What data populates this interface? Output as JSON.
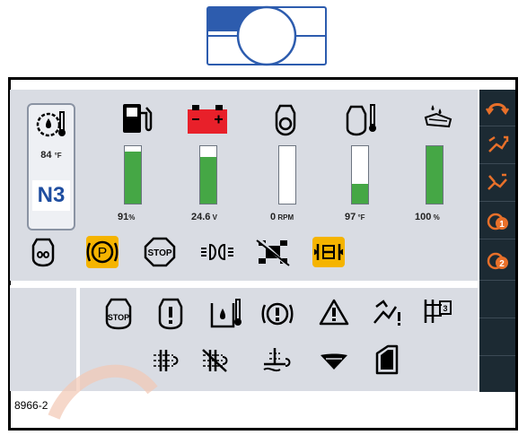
{
  "engine": {
    "temp_value": "84",
    "temp_unit": "°F",
    "gear": "N3"
  },
  "gauges": [
    {
      "name": "fuel",
      "value": "91",
      "unit": "%",
      "level": 0.91
    },
    {
      "name": "battery",
      "value": "24.6",
      "unit": "V",
      "level": 0.82
    },
    {
      "name": "engine-speed",
      "value": "0",
      "unit": "RPM",
      "level": 0.0
    },
    {
      "name": "coolant",
      "value": "97",
      "unit": "°F",
      "level": 0.35
    },
    {
      "name": "def",
      "value": "100",
      "unit": "%",
      "level": 1.0
    }
  ],
  "figure_code": "8966-2",
  "colors": {
    "gauge_fill": "#45a745",
    "warning_amber": "#f5b400",
    "alarm_red": "#e8202a",
    "sidebar": "#1c2a33",
    "gear_blue": "#1f4ea0"
  }
}
